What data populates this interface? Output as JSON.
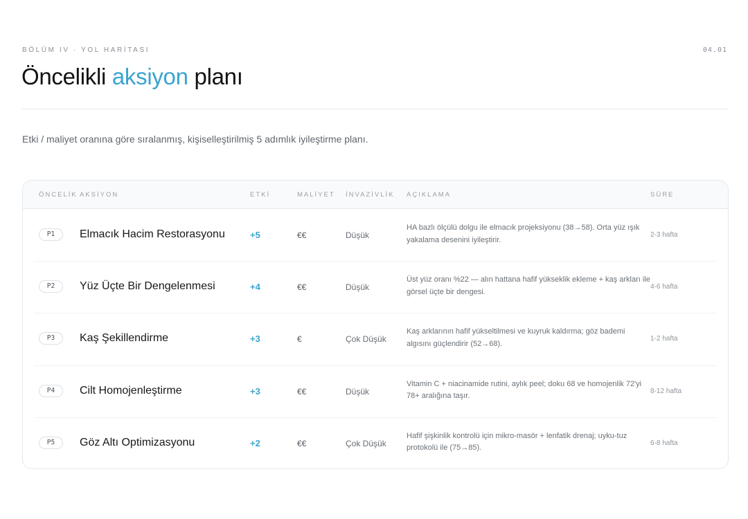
{
  "header": {
    "eyebrow": "BÖLÜM IV · YOL HARİTASI",
    "page_number": "04.01",
    "title_before": "Öncelikli ",
    "title_accent": "aksiyon",
    "title_after": " planı",
    "subtitle": "Etki / maliyet oranına göre sıralanmış, kişiselleştirilmiş 5 adımlık iyileştirme planı."
  },
  "colors": {
    "accent": "#3aa4cf",
    "text": "#111214",
    "muted": "#8a8f96",
    "border": "#e4e7eb"
  },
  "table": {
    "columns": {
      "priority": "ÖNCELİK",
      "action": "AKSİYON",
      "impact": "ETKİ",
      "cost": "MALİYET",
      "invasiveness": "İNVAZİVLİK",
      "description": "AÇIKLAMA",
      "duration": "SÜRE"
    },
    "rows": [
      {
        "priority": "P1",
        "action": "Elmacık Hacim Restorasyonu",
        "impact": "+5",
        "cost": "€€",
        "invasiveness": "Düşük",
        "description": "HA bazlı ölçülü dolgu ile elmacık projeksiyonu (38→58). Orta yüz ışık yakalama desenini iyileştirir.",
        "duration": "2-3 hafta"
      },
      {
        "priority": "P2",
        "action": "Yüz Üçte Bir Dengelenmesi",
        "impact": "+4",
        "cost": "€€",
        "invasiveness": "Düşük",
        "description": "Üst yüz oranı %22 — alın hattana hafif yükseklik ekleme + kaş arkları ile görsel üçte bir dengesi.",
        "duration": "4-6 hafta"
      },
      {
        "priority": "P3",
        "action": "Kaş Şekillendirme",
        "impact": "+3",
        "cost": "€",
        "invasiveness": "Çok Düşük",
        "description": "Kaş arklarının hafif yükseltilmesi ve kuyruk kaldırma; göz bademi algısını güçlendirir (52→68).",
        "duration": "1-2 hafta"
      },
      {
        "priority": "P4",
        "action": "Cilt Homojenleştirme",
        "impact": "+3",
        "cost": "€€",
        "invasiveness": "Düşük",
        "description": "Vitamin C + niacinamide rutini, aylık peel; doku 68 ve homojenlik 72'yi 78+ aralığına taşır.",
        "duration": "8-12 hafta"
      },
      {
        "priority": "P5",
        "action": "Göz Altı Optimizasyonu",
        "impact": "+2",
        "cost": "€€",
        "invasiveness": "Çok Düşük",
        "description": "Hafif şişkinlik kontrolü için mikro-masör + lenfatik drenaj; uyku-tuz protokolü ile (75→85).",
        "duration": "6-8 hafta"
      }
    ]
  }
}
